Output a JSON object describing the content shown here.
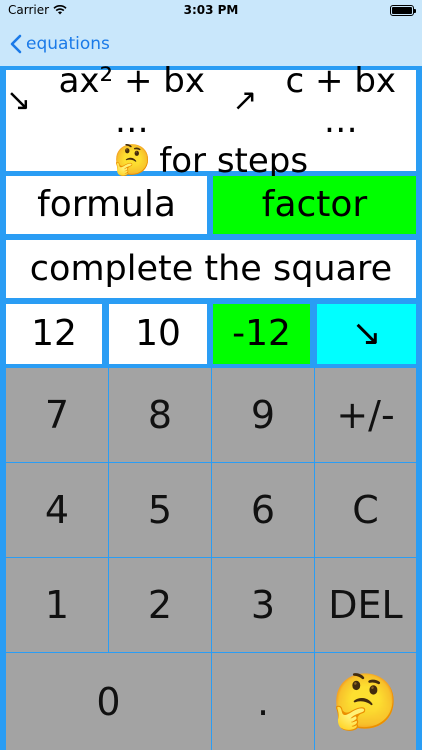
{
  "status": {
    "carrier": "Carrier",
    "time": "3:03 PM"
  },
  "nav": {
    "back_label": "equations"
  },
  "equation": {
    "arrow1": "↘",
    "expr1": "ax² + bx …",
    "arrow2": "↗",
    "expr2": "c + bx …",
    "think_emoji": "🤔",
    "hint": "for steps"
  },
  "methods": {
    "formula": "formula",
    "factor": "factor",
    "complete": "complete the square"
  },
  "coeffs": {
    "a": "12",
    "b": "10",
    "c": "-12",
    "toggle": "↘"
  },
  "keypad": {
    "rows": [
      [
        "7",
        "8",
        "9",
        "+/-"
      ],
      [
        "4",
        "5",
        "6",
        "C"
      ],
      [
        "1",
        "2",
        "3",
        "DEL"
      ]
    ],
    "zero": "0",
    "dot": ".",
    "think": "🤔"
  },
  "colors": {
    "accent": "#2a9df4",
    "selected": "#00ff00",
    "cyan": "#00ffff",
    "key": "#a3a3a3"
  }
}
